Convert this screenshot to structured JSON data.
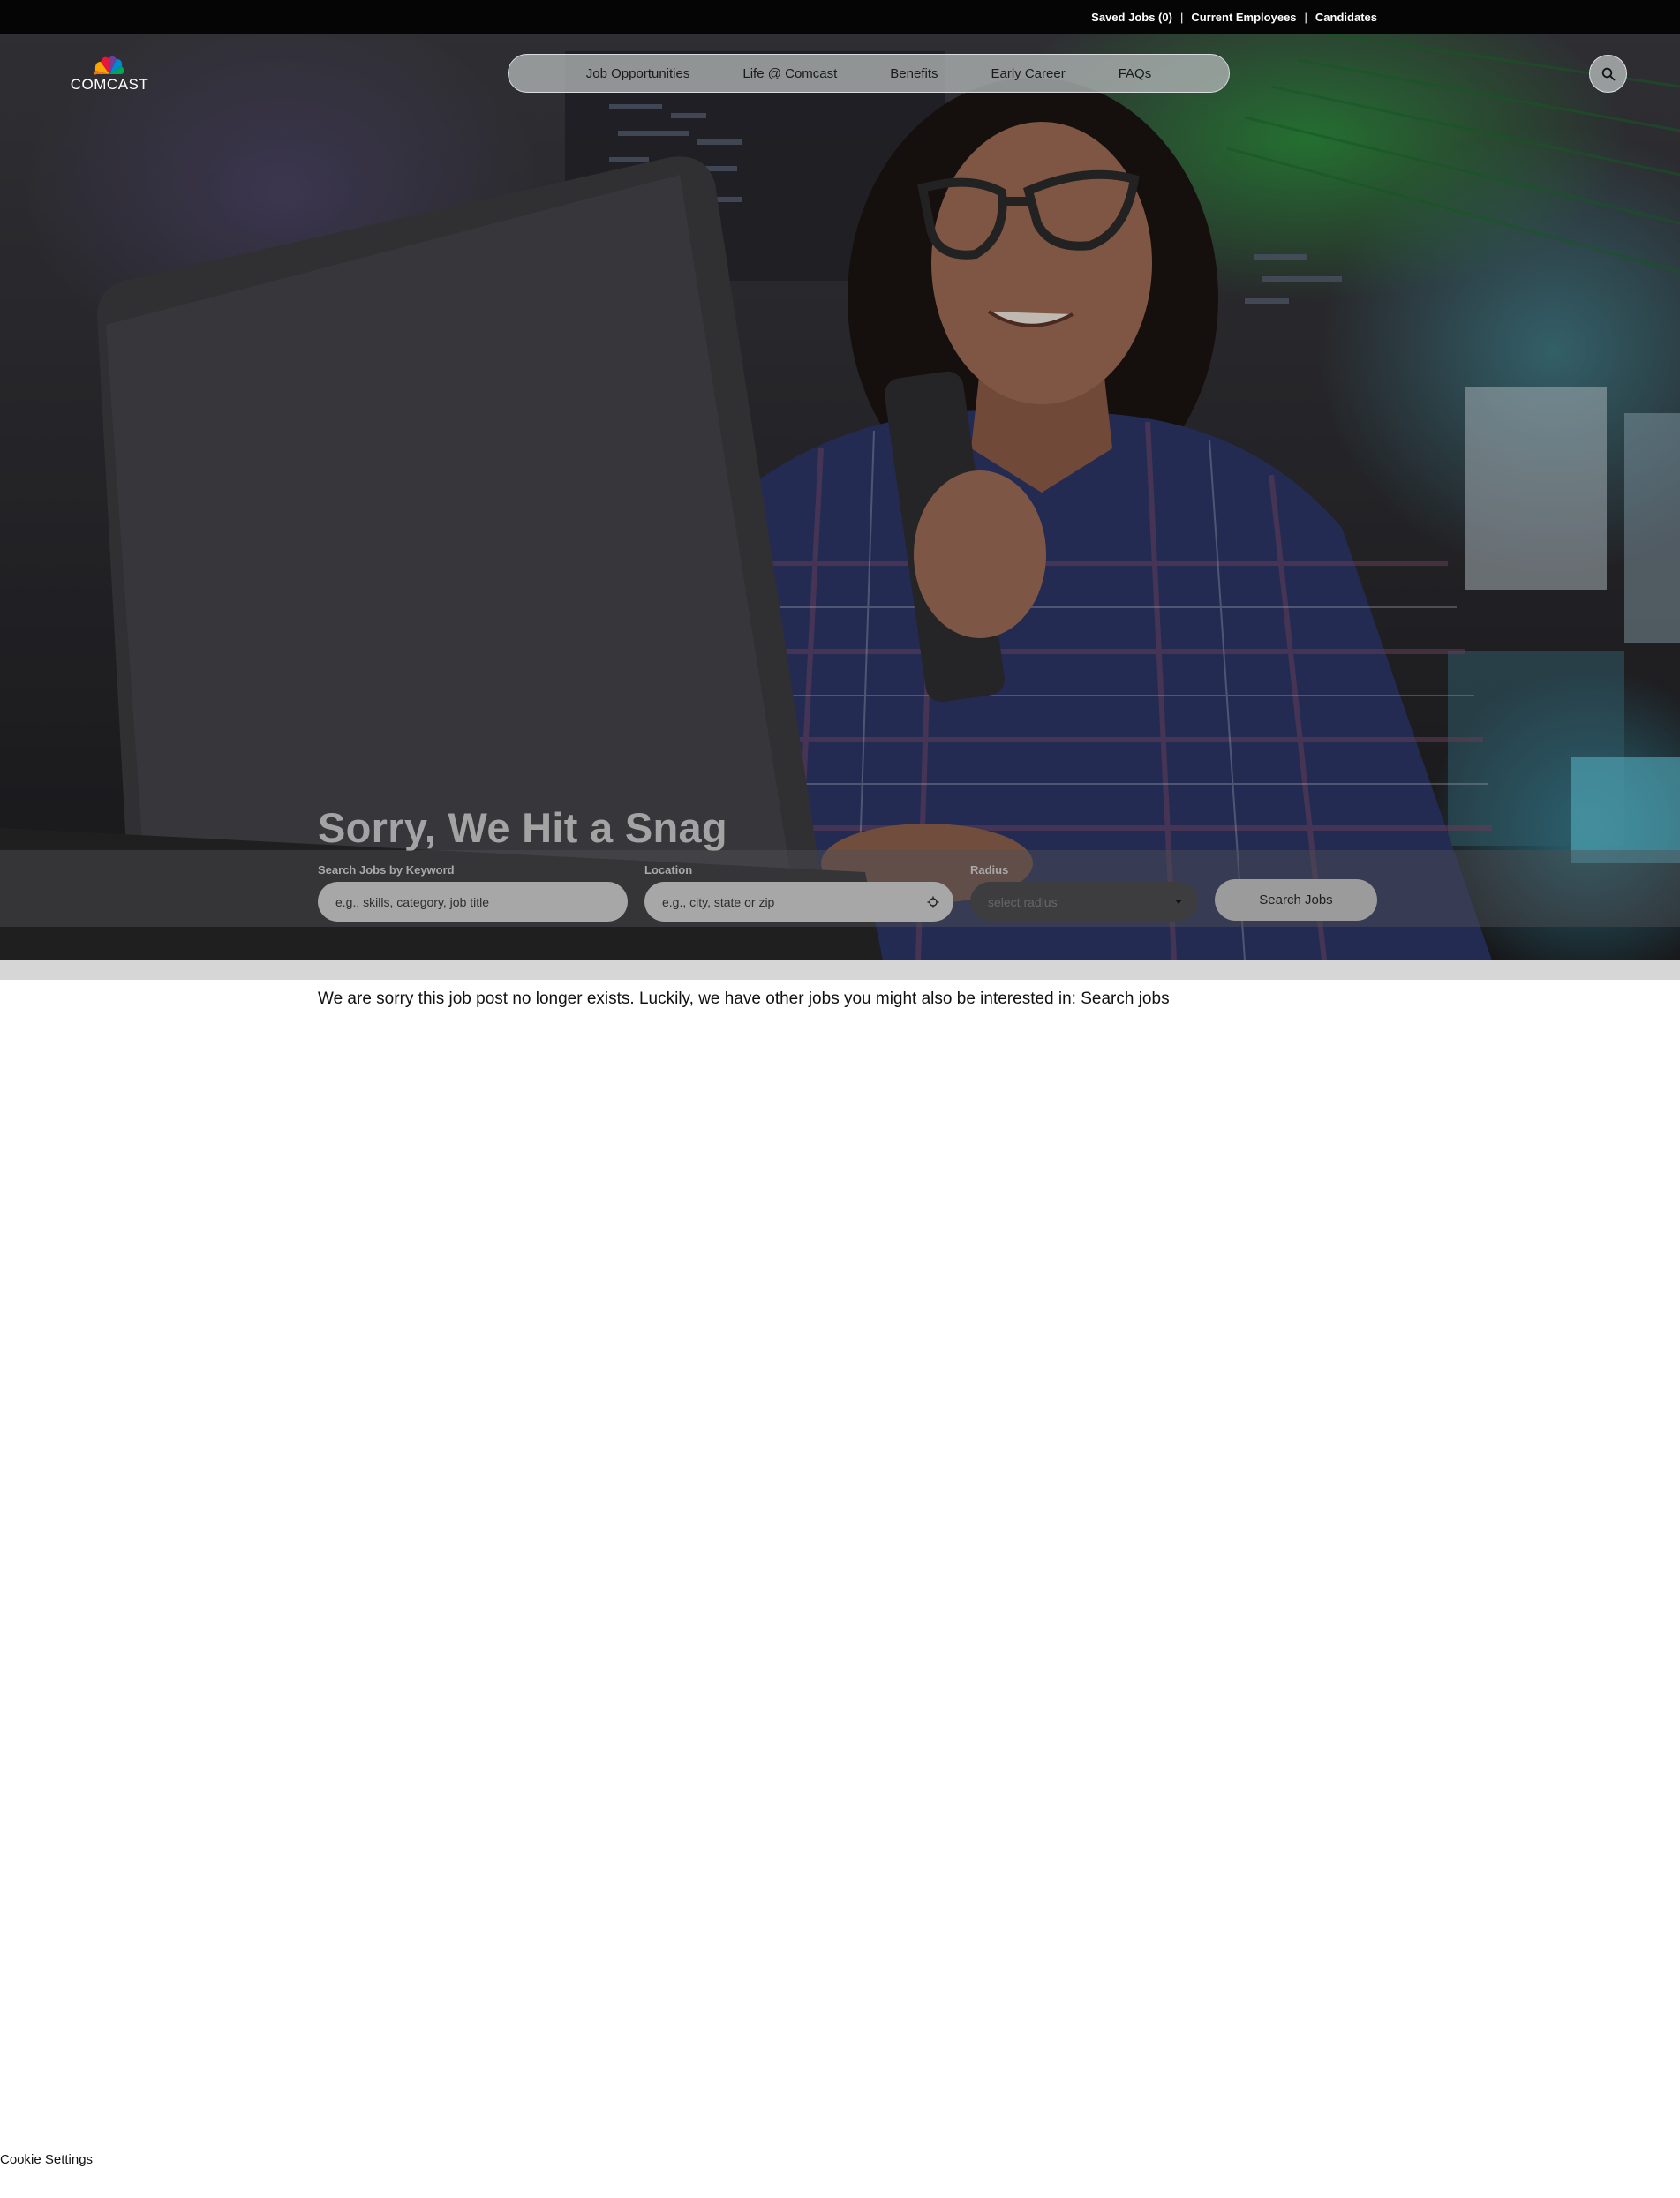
{
  "utility_nav": {
    "saved_jobs": "Saved Jobs (0)",
    "current_employees": "Current Employees",
    "candidates": "Candidates",
    "separator": "|"
  },
  "brand": {
    "logo_text": "COMCAST",
    "logo_icon": "peacock-logo-icon"
  },
  "main_nav": {
    "items": [
      {
        "label": "Job Opportunities"
      },
      {
        "label": "Life @ Comcast"
      },
      {
        "label": "Benefits"
      },
      {
        "label": "Early Career"
      },
      {
        "label": "FAQs"
      }
    ],
    "search_icon": "search-icon"
  },
  "hero": {
    "title": "Sorry, We Hit a Snag"
  },
  "search": {
    "keyword_label": "Search Jobs by Keyword",
    "keyword_placeholder": "e.g., skills, category, job title",
    "location_label": "Location",
    "location_placeholder": "e.g., city, state or zip",
    "location_icon": "locate-icon",
    "radius_label": "Radius",
    "radius_placeholder": "select radius",
    "radius_icon": "caret-down-icon",
    "button_label": "Search Jobs"
  },
  "content": {
    "message": "We are sorry this job post no longer exists. Luckily, we have other jobs you might also be interested in:",
    "link_label": "Search jobs"
  },
  "footer": {
    "cookie_settings": "Cookie Settings"
  },
  "colors": {
    "utility_bar": "#050505",
    "nav_pill": "#aaafaf",
    "divider": "#d6d6d6"
  }
}
